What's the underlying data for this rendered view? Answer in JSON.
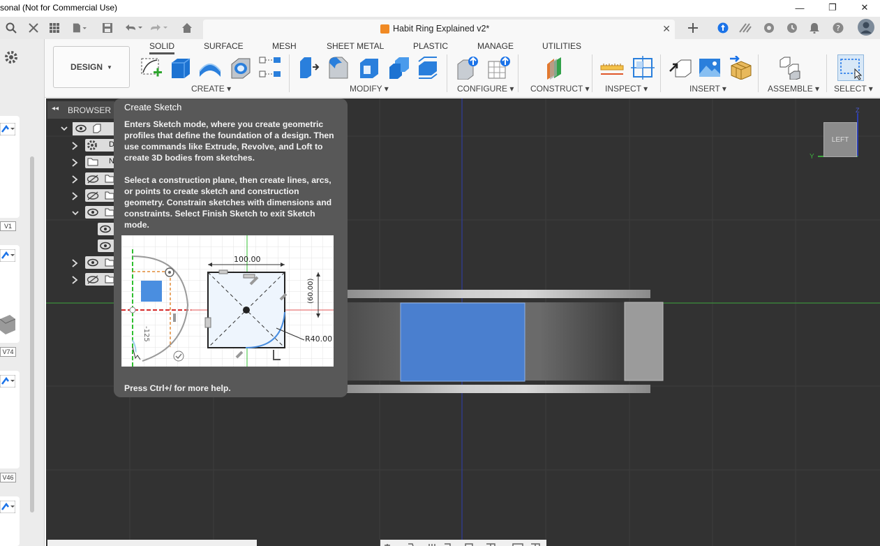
{
  "window": {
    "title": "sonal (Not for Commercial Use)",
    "minimize": "—",
    "maximize": "❐",
    "close": "✕"
  },
  "document_tab": {
    "label": "Habit Ring Explained v2*",
    "close": "✕"
  },
  "toolbar": {
    "workspace": "DESIGN",
    "tabs": [
      "SOLID",
      "SURFACE",
      "MESH",
      "SHEET METAL",
      "PLASTIC",
      "MANAGE",
      "UTILITIES"
    ],
    "active_tab": "SOLID",
    "groups": [
      "CREATE",
      "MODIFY",
      "CONFIGURE",
      "CONSTRUCT",
      "INSPECT",
      "INSERT",
      "ASSEMBLE",
      "SELECT"
    ]
  },
  "browser": {
    "title": "BROWSER",
    "collapse": "◂◂",
    "partial_labels": [
      "D",
      "N"
    ]
  },
  "left_badges": [
    "V1",
    "V74",
    "V46"
  ],
  "tooltip": {
    "title": "Create Sketch",
    "paragraph1": "Enters Sketch mode, where you create geometric profiles that define the foundation of a design. Then use commands like Extrude, Revolve, and Loft to create 3D bodies from sketches.",
    "paragraph2": "Select a construction plane, then create lines, arcs, or points to create sketch and construction geometry. Constrain sketches with dimensions and constraints. Select Finish Sketch to exit Sketch mode.",
    "footer": "Press Ctrl+/ for more help.",
    "illustration": {
      "dim_width": "100.00",
      "dim_height": "(60.00)",
      "dim_radius": "R40.00",
      "dim_side": "-125"
    }
  },
  "viewcube": {
    "face": "LEFT",
    "axis_y": "Y",
    "axis_z": "Z"
  },
  "colors": {
    "canvas": "#323232",
    "body_blue": "#4a7fcf",
    "grid_green": "#3ea83e",
    "axis_blue": "#2d3fb0"
  }
}
